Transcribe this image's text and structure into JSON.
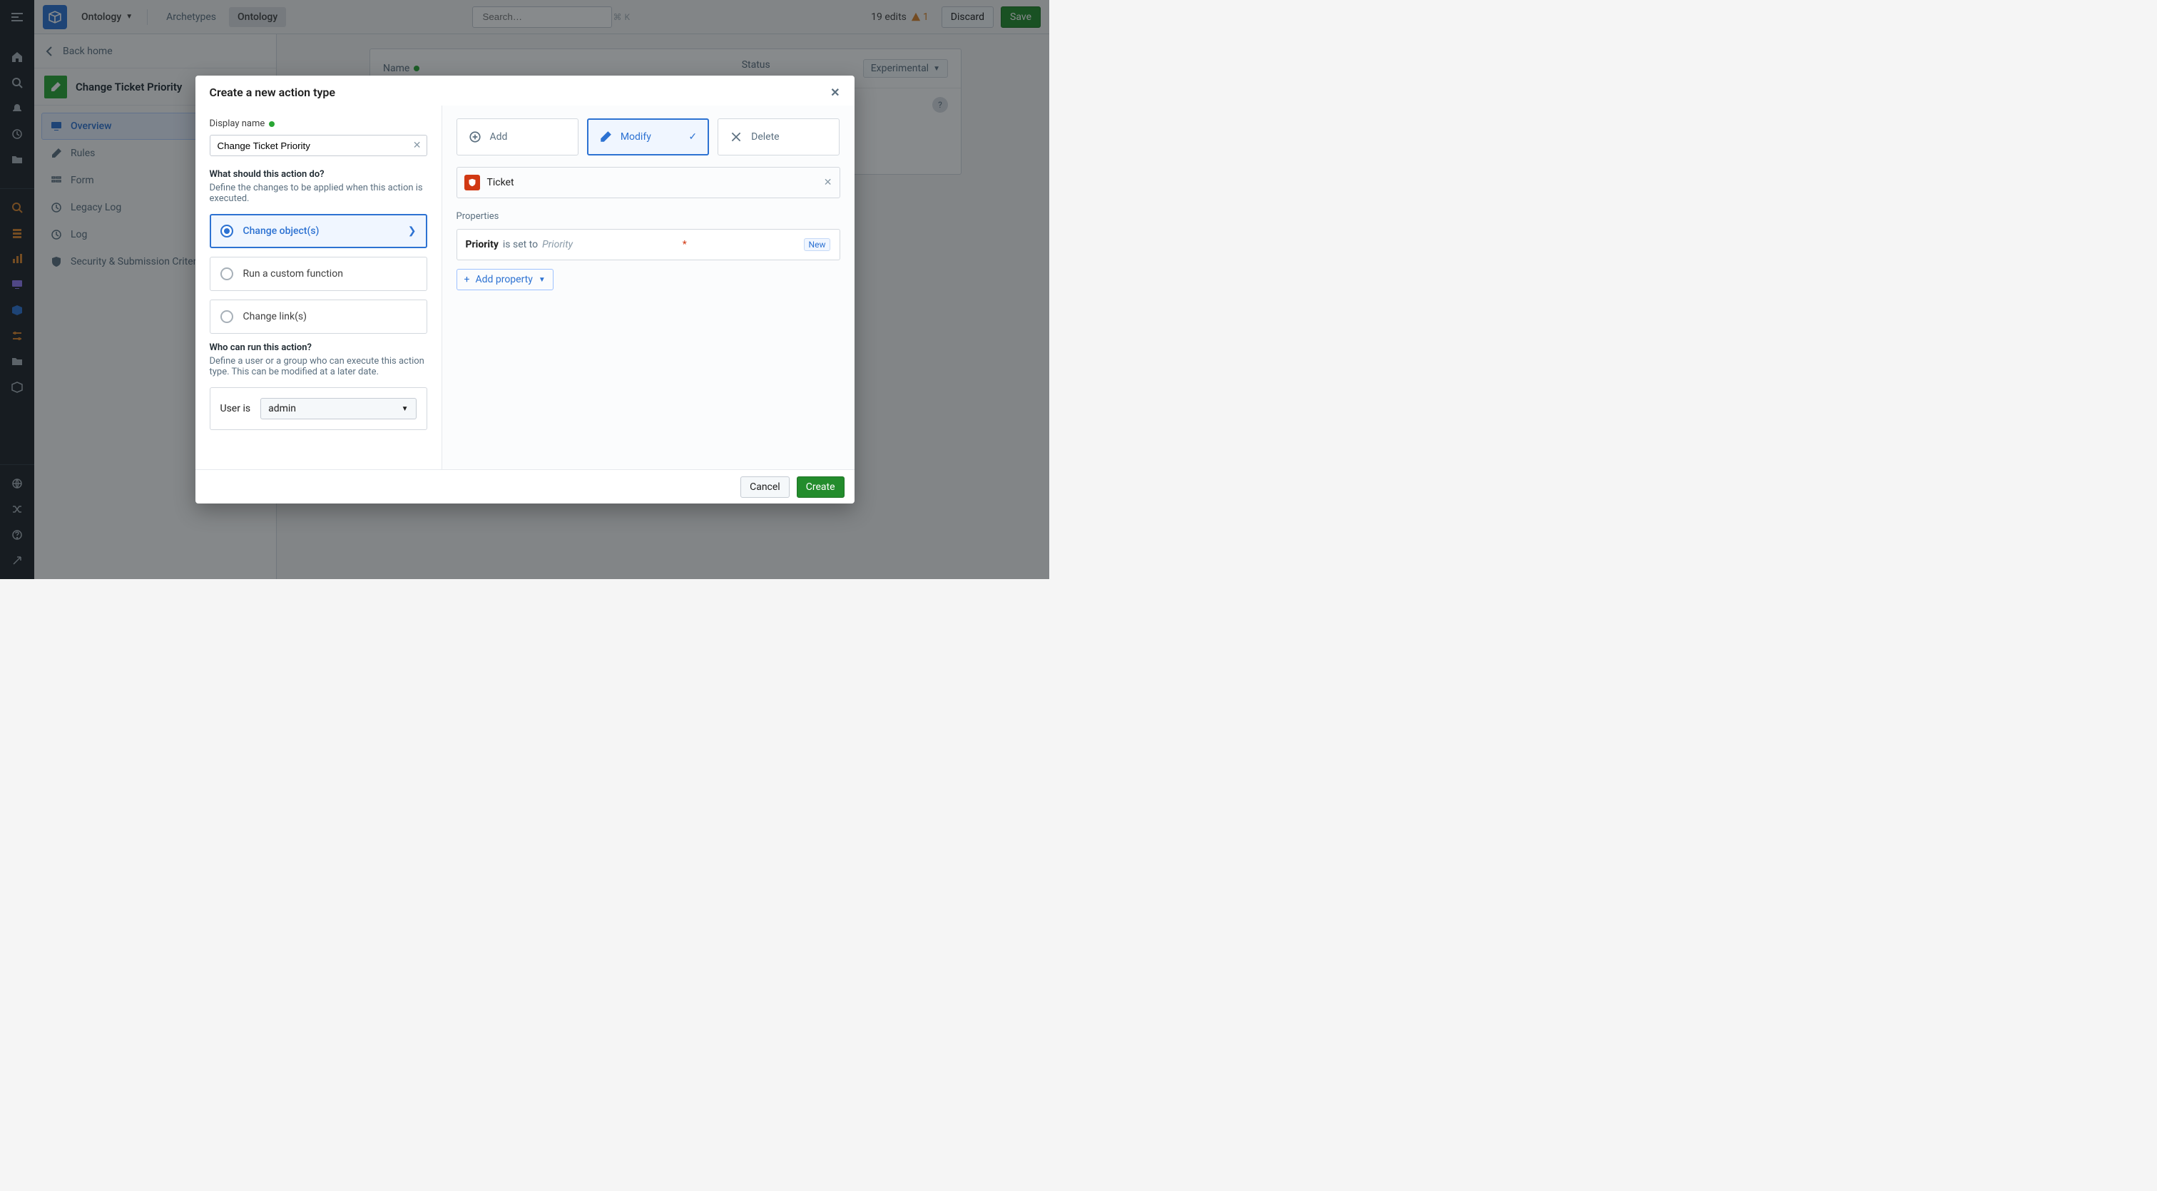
{
  "topbar": {
    "ontology_dd": "Ontology",
    "tab_archetypes": "Archetypes",
    "tab_ontology": "Ontology",
    "search_placeholder": "Search…",
    "search_kbd1": "⌘",
    "search_kbd2": "K",
    "edits_text": "19 edits",
    "warn_count": "1",
    "discard": "Discard",
    "save": "Save"
  },
  "side2": {
    "back": "Back home",
    "title": "Change Ticket Priority",
    "nav": {
      "overview": "Overview",
      "rules": "Rules",
      "form": "Form",
      "legacy_log": "Legacy Log",
      "log": "Log",
      "security": "Security & Submission Criteria"
    }
  },
  "bg": {
    "name_col": "Name",
    "status_col": "Status",
    "experimental": "Experimental"
  },
  "modal": {
    "title": "Create a new action type",
    "left": {
      "display_name_label": "Display name",
      "display_name_value": "Change Ticket Priority",
      "what_label": "What should this action do?",
      "what_sub": "Define the changes to be applied when this action is executed.",
      "opt_change_objects": "Change object(s)",
      "opt_run_fn": "Run a custom function",
      "opt_change_links": "Change link(s)",
      "who_label": "Who can run this action?",
      "who_sub": "Define a user or a group who can execute this action type. This can be modified at a later date.",
      "user_is": "User is",
      "user_value": "admin"
    },
    "right": {
      "op_add": "Add",
      "op_modify": "Modify",
      "op_delete": "Delete",
      "object_type": "Ticket",
      "props_label": "Properties",
      "prop_name": "Priority",
      "prop_mid": " is set to ",
      "prop_value": "Priority",
      "new_tag": "New",
      "add_prop": "Add property"
    },
    "foot": {
      "cancel": "Cancel",
      "create": "Create"
    }
  }
}
